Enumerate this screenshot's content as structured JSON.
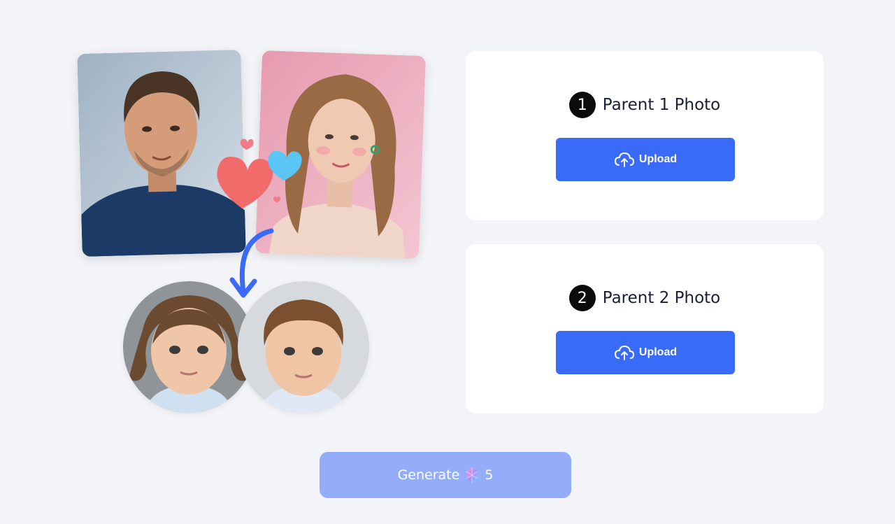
{
  "parent1": {
    "step": "1",
    "title": "Parent 1 Photo",
    "upload_label": "Upload",
    "icon": "cloud-upload-icon"
  },
  "parent2": {
    "step": "2",
    "title": "Parent 2 Photo",
    "upload_label": "Upload",
    "icon": "cloud-upload-icon"
  },
  "generate": {
    "label": "Generate",
    "cost": "5",
    "icon": "gem-icon"
  },
  "colors": {
    "primary": "#3a6af8",
    "primary_disabled": "#93adfb",
    "background": "#f3f4f8"
  }
}
